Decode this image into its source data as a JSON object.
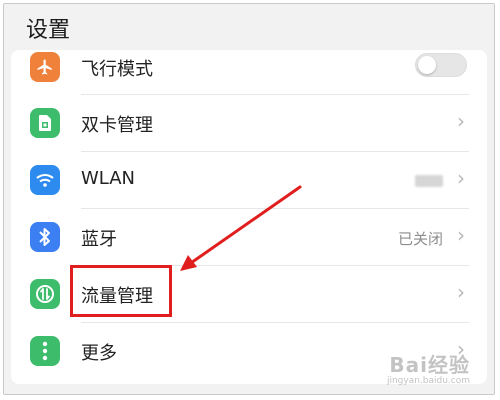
{
  "header": {
    "title": "设置"
  },
  "settings": {
    "items": [
      {
        "id": "airplane",
        "label": "飞行模式",
        "icon": "airplane-icon",
        "icon_color": "#f0813a",
        "control": "toggle",
        "toggle_on": false
      },
      {
        "id": "dual-sim",
        "label": "双卡管理",
        "icon": "sim-card-icon",
        "icon_color": "#3dbc6b",
        "control": "chevron"
      },
      {
        "id": "wlan",
        "label": "WLAN",
        "icon": "wifi-icon",
        "icon_color": "#2d8bef",
        "control": "chevron",
        "value_blurred": true
      },
      {
        "id": "bluetooth",
        "label": "蓝牙",
        "icon": "bluetooth-icon",
        "icon_color": "#3b7ff2",
        "control": "chevron",
        "value": "已关闭"
      },
      {
        "id": "data-usage",
        "label": "流量管理",
        "icon": "data-usage-icon",
        "icon_color": "#3dbc6b",
        "control": "chevron",
        "highlighted": true
      },
      {
        "id": "more",
        "label": "更多",
        "icon": "more-icon",
        "icon_color": "#3dbc6b",
        "control": "chevron"
      }
    ]
  },
  "annotation": {
    "color": "#e01e1e"
  },
  "watermark": {
    "main": "Bai经验",
    "sub": "jingyan.baidu.com"
  }
}
